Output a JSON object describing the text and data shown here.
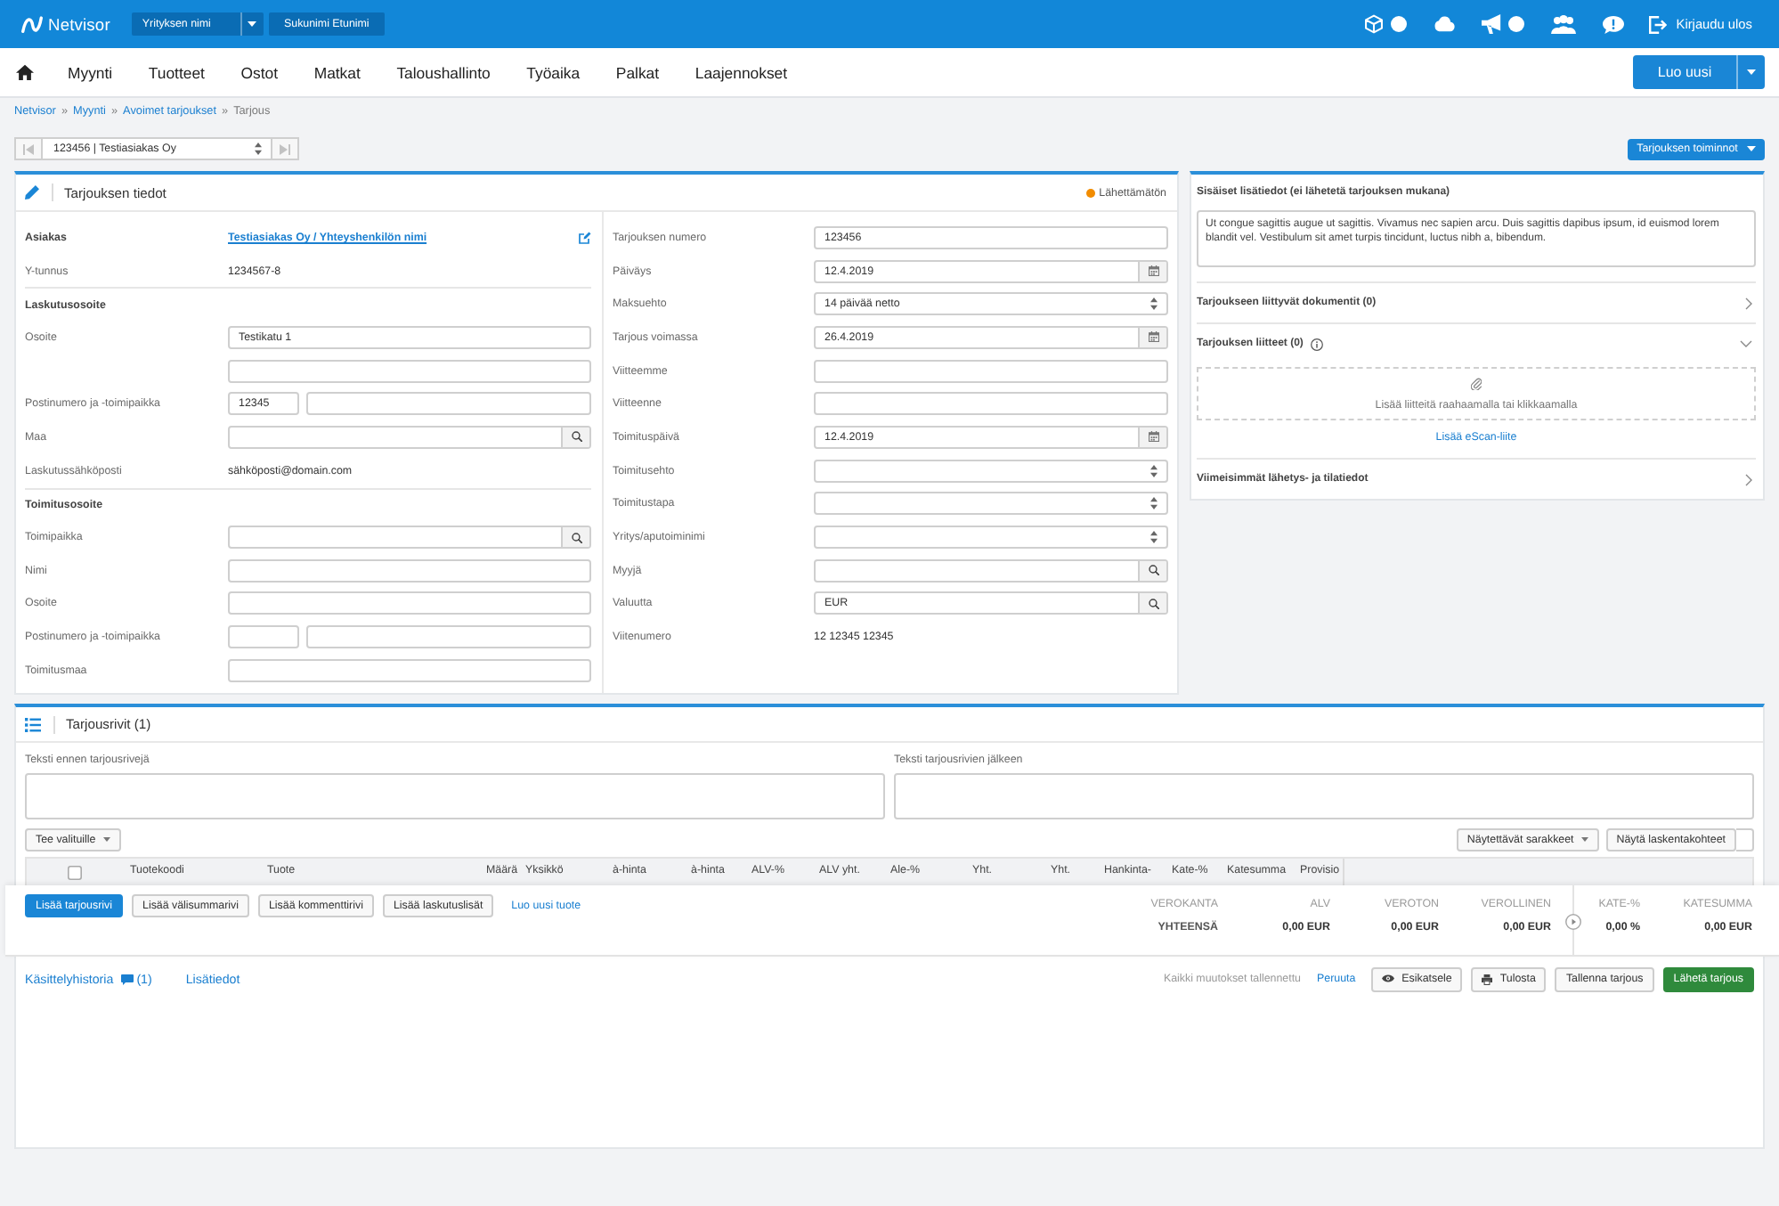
{
  "top_bar": {
    "logo": "Netvisor",
    "company": "Yrityksen nimi",
    "user": "Sukunimi Etunimi",
    "icons": [
      {
        "kind": "cube",
        "badge": true
      },
      {
        "kind": "cloud",
        "badge": false
      },
      {
        "kind": "megaphone",
        "badge": true
      },
      {
        "kind": "people",
        "badge": false
      },
      {
        "kind": "chat",
        "badge": false
      }
    ],
    "logout": "Kirjaudu ulos"
  },
  "nav": {
    "items": [
      "Myynti",
      "Tuotteet",
      "Ostot",
      "Matkat",
      "Taloushallinto",
      "Työaika",
      "Palkat",
      "Laajennokset"
    ],
    "create_button": "Luo uusi"
  },
  "breadcrumb": [
    {
      "kind": "link",
      "label": "Netvisor"
    },
    {
      "kind": "sep",
      "label": "»"
    },
    {
      "kind": "link",
      "label": "Myynti"
    },
    {
      "kind": "sep",
      "label": "»"
    },
    {
      "kind": "link",
      "label": "Avoimet tarjoukset"
    },
    {
      "kind": "sep",
      "label": "»"
    },
    {
      "kind": "current",
      "label": "Tarjous"
    }
  ],
  "record_nav": {
    "value": "123456 | Testiasiakas Oy",
    "first_disabled": true,
    "last_disabled": true,
    "actions_button": "Tarjouksen toiminnot"
  },
  "offer_details": {
    "title": "Tarjouksen tiedot",
    "status": {
      "label": "Lähettämätön",
      "color": "#f28c00"
    },
    "left_rows": [
      {
        "kind": "customer",
        "label": "Asiakas",
        "value": "Testiasiakas Oy / Yhteyshenkilön nimi"
      },
      {
        "kind": "text",
        "label": "Y-tunnus",
        "value": "1234567-8"
      },
      {
        "kind": "heading",
        "label": "Laskutusosoite"
      },
      {
        "kind": "input",
        "label": "Osoite",
        "value": "Testikatu 1"
      },
      {
        "kind": "input"
      },
      {
        "kind": "pair",
        "label": "Postinumero ja -toimipaikka",
        "value": "12345"
      },
      {
        "kind": "search",
        "label": "Maa"
      },
      {
        "kind": "text",
        "label": "Laskutussähköposti",
        "value": "sähköposti@domain.com"
      },
      {
        "kind": "heading",
        "label": "Toimitusosoite"
      },
      {
        "kind": "search",
        "label": "Toimipaikka"
      },
      {
        "kind": "input",
        "label": "Nimi"
      },
      {
        "kind": "input",
        "label": "Osoite"
      },
      {
        "kind": "pair",
        "label": "Postinumero ja -toimipaikka"
      },
      {
        "kind": "input",
        "label": "Toimitusmaa"
      }
    ],
    "right_rows": [
      {
        "kind": "input",
        "label": "Tarjouksen numero",
        "value": "123456"
      },
      {
        "kind": "date",
        "label": "Päiväys",
        "value": "12.4.2019"
      },
      {
        "kind": "select",
        "label": "Maksuehto",
        "value": "14 päivää netto"
      },
      {
        "kind": "date",
        "label": "Tarjous voimassa",
        "value": "26.4.2019"
      },
      {
        "kind": "input",
        "label": "Viitteemme"
      },
      {
        "kind": "input",
        "label": "Viitteenne"
      },
      {
        "kind": "date",
        "label": "Toimituspäivä",
        "value": "12.4.2019"
      },
      {
        "kind": "select",
        "label": "Toimitusehto"
      },
      {
        "kind": "select",
        "label": "Toimitustapa"
      },
      {
        "kind": "select",
        "label": "Yritys/aputoiminimi"
      },
      {
        "kind": "search",
        "label": "Myyjä"
      },
      {
        "kind": "search",
        "label": "Valuutta",
        "value": "EUR"
      },
      {
        "kind": "text",
        "label": "Viitenumero",
        "value": "12 12345 12345"
      }
    ]
  },
  "side_panel": {
    "notes_title": "Sisäiset lisätiedot (ei lähetetä tarjouksen mukana)",
    "notes": "Ut congue sagittis augue ut sagittis. Vivamus nec sapien arcu. Duis sagittis dapibus ipsum, id euismod lorem blandit vel. Vestibulum sit amet turpis tincidunt, luctus nibh a, bibendum.",
    "sections": [
      {
        "title": "Tarjoukseen liittyvät dokumentit (0)",
        "expanded": false,
        "info": false
      },
      {
        "title": "Tarjouksen liitteet (0)",
        "expanded": true,
        "info": true,
        "drop_text": "Lisää liitteitä raahaamalla tai klikkaamalla",
        "link": "Lisää eScan-liite"
      },
      {
        "title": "Viimeisimmät lähetys- ja tilatiedot",
        "expanded": false,
        "info": false
      }
    ]
  },
  "offer_rows": {
    "title": "Tarjousrivit (1)",
    "text_before": {
      "label": "Teksti ennen tarjousrivejä"
    },
    "text_after": {
      "label": "Teksti tarjousrivien jälkeen"
    },
    "bulk_button": "Tee valituille",
    "columns_button": "Näytettävät sarakkeet",
    "targets_button": "Näytä laskentakohteet",
    "select_all": {
      "checked": false
    },
    "columns": [
      "Tuotekoodi",
      "Tuote",
      "Määrä",
      "Yksikkö",
      "à-hinta",
      "à-hinta",
      "ALV-%",
      "ALV yht.",
      "Ale-%",
      "Yht.",
      "Yht.",
      "Hankinta-",
      "Kate-%",
      "Katesumma",
      "Provisio"
    ],
    "add_buttons": [
      {
        "label": "Lisää tarjousrivi",
        "kind": "primary"
      },
      {
        "label": "Lisää välisummarivi",
        "kind": "default"
      },
      {
        "label": "Lisää kommenttirivi",
        "kind": "default"
      },
      {
        "label": "Lisää laskutuslisät",
        "kind": "default"
      },
      {
        "label": "Luo uusi tuote",
        "kind": "link"
      }
    ],
    "totals": {
      "headers": [
        "VEROKANTA",
        "ALV",
        "VEROTON",
        "VEROLLINEN",
        "KATE-%",
        "KATESUMMA"
      ],
      "values": [
        "YHTEENSÄ",
        "0,00 EUR",
        "0,00 EUR",
        "0,00 EUR",
        "0,00 %",
        "0,00 EUR"
      ]
    }
  },
  "footer": {
    "tabs": [
      {
        "label": "Käsittelyhistoria",
        "count": "(1)"
      },
      {
        "label": "Lisätiedot"
      }
    ],
    "saved_text": "Kaikki muutokset tallennettu",
    "buttons": [
      {
        "label": "Peruuta",
        "kind": "link"
      },
      {
        "label": "Esikatsele",
        "kind": "eye"
      },
      {
        "label": "Tulosta",
        "kind": "printer"
      },
      {
        "label": "Tallenna tarjous",
        "kind": "default"
      },
      {
        "label": "Lähetä tarjous",
        "kind": "success"
      }
    ]
  }
}
